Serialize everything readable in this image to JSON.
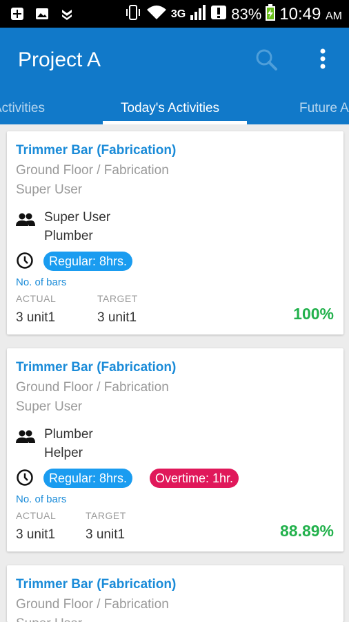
{
  "status_bar": {
    "battery": "83%",
    "network": "3G",
    "time": "10:49",
    "ampm": "AM"
  },
  "app_bar": {
    "title": "Project A"
  },
  "tabs": [
    {
      "label": "Activities"
    },
    {
      "label": "Today's Activities"
    },
    {
      "label": "Future Activities"
    }
  ],
  "cards": [
    {
      "title": "Trimmer Bar (Fabrication)",
      "location": "Ground Floor / Fabrication",
      "owner": "Super User",
      "people": [
        "Super User",
        "Plumber"
      ],
      "hours": {
        "regular": "Regular: 8hrs."
      },
      "measure": "No. of bars",
      "actual_label": "ACTUAL",
      "target_label": "TARGET",
      "actual": "3 unit1",
      "target": "3 unit1",
      "percent": "100%"
    },
    {
      "title": "Trimmer Bar (Fabrication)",
      "location": "Ground Floor / Fabrication",
      "owner": "Super User",
      "people": [
        "Plumber",
        "Helper"
      ],
      "hours": {
        "regular": "Regular: 8hrs.",
        "overtime": "Overtime: 1hr."
      },
      "measure": "No. of bars",
      "actual_label": "ACTUAL",
      "target_label": "TARGET",
      "actual": "3 unit1",
      "target": "3 unit1",
      "percent": "88.89%"
    },
    {
      "title": "Trimmer Bar (Fabrication)",
      "location": "Ground Floor / Fabrication",
      "owner": "Super User"
    }
  ],
  "colors": {
    "primary": "#1179c9",
    "link": "#1a8bd8",
    "regular_chip": "#1a9cf0",
    "overtime_chip": "#e0185a",
    "percent": "#22b14c"
  }
}
